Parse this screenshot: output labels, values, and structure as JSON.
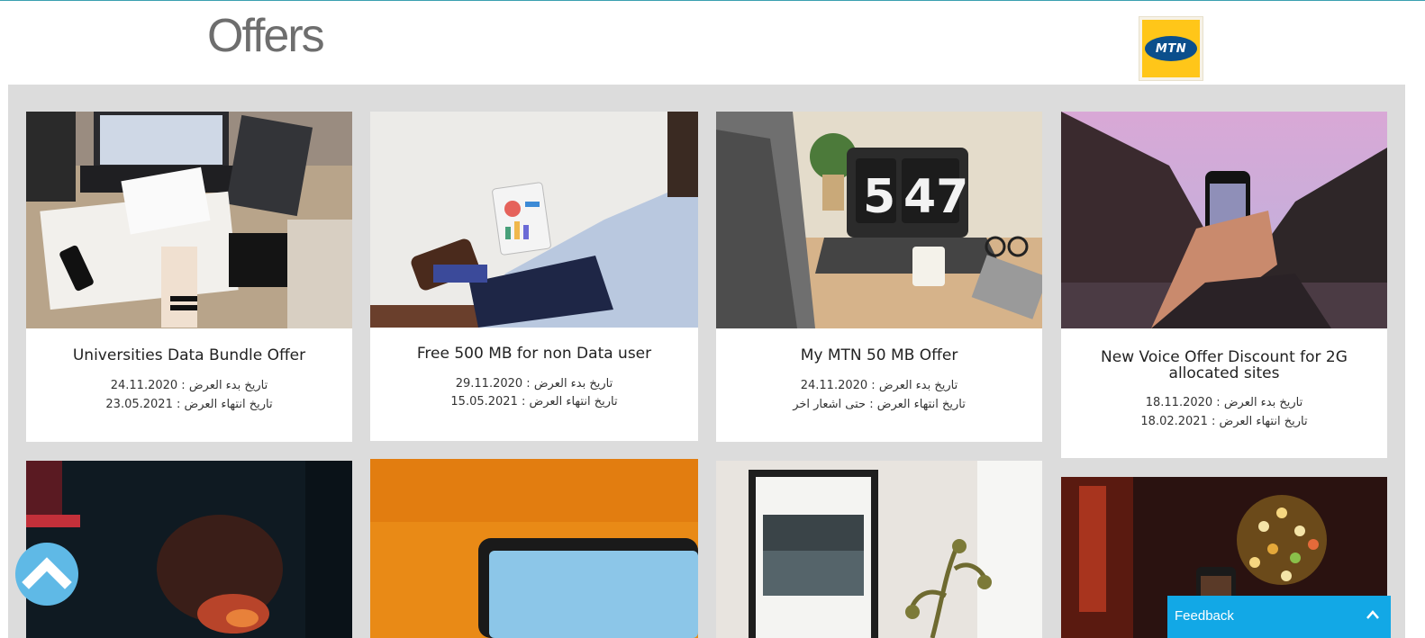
{
  "header": {
    "title": "Offers",
    "logo_text": "MTN"
  },
  "colors": {
    "page_background": "#ffffff",
    "grid_background": "#dcdcdc",
    "mtn_yellow": "#ffc619",
    "mtn_blue": "#0b4f8c",
    "feedback_blue": "#12a8e6",
    "scroll_button": "#5fb9e6"
  },
  "offers": [
    {
      "title": "Universities Data Bundle Offer",
      "start": "تاريخ بدء العرض : 24.11.2020",
      "end": "تاريخ انتهاء العرض : 23.05.2021",
      "photo": "photo-desk-laptops-notes"
    },
    {
      "title": "Free 500 MB for non Data user",
      "start": "تاريخ بدء العرض : 29.11.2020",
      "end": "تاريخ انتهاء العرض : 15.05.2021",
      "photo": "photo-man-with-tablet-charts"
    },
    {
      "title": "My MTN 50 MB Offer",
      "start": "تاريخ بدء العرض : 24.11.2020",
      "end": "تاريخ انتهاء العرض : حتى اشعار اخر",
      "photo": "photo-laptop-clock-547"
    },
    {
      "title": "New Voice Offer Discount for 2G allocated sites",
      "start": "تاريخ بدء العرض : 18.11.2020",
      "end": "تاريخ انتهاء العرض : 18.02.2021",
      "photo": "photo-phone-mountains-sunset"
    },
    {
      "photo": "photo-dark-red-light"
    },
    {
      "photo": "photo-laptop-orange-wall"
    },
    {
      "photo": "photo-framed-picture-plant"
    },
    {
      "photo": "photo-phone-bokeh-lights"
    }
  ],
  "feedback": {
    "label": "Feedback",
    "chevron_icon": "chevron-up-icon"
  },
  "scroll_top": {
    "icon": "chevron-up-icon"
  }
}
